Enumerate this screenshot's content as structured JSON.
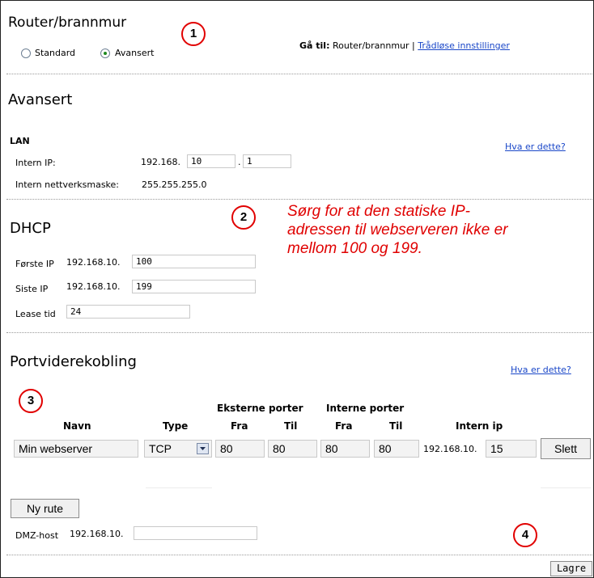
{
  "page": {
    "title": "Router/brannmur",
    "mode_options": [
      {
        "label": "Standard",
        "selected": false
      },
      {
        "label": "Avansert",
        "selected": true
      }
    ],
    "goto_label": "Gå til:",
    "goto_current": "Router/brannmur",
    "goto_separator": "|",
    "goto_link": "Trådløse innstillinger"
  },
  "callouts": [
    "1",
    "2",
    "3",
    "4"
  ],
  "advanced": {
    "heading": "Avansert",
    "lan_label": "LAN",
    "help_link": "Hva er dette?",
    "intern_ip_label": "Intern IP:",
    "intern_ip_prefix": "192.168.",
    "intern_ip_octet3": "10",
    "intern_ip_dot": ".",
    "intern_ip_octet4": "1",
    "netmask_label": "Intern nettverksmaske:",
    "netmask_value": "255.255.255.0"
  },
  "dhcp": {
    "heading": "DHCP",
    "first_ip_label": "Første IP",
    "first_ip_prefix": "192.168.10.",
    "first_ip_value": "100",
    "last_ip_label": "Siste IP",
    "last_ip_prefix": "192.168.10.",
    "last_ip_value": "199",
    "lease_label": "Lease tid",
    "lease_value": "24"
  },
  "annotation": {
    "line1": "Sørg for at den statiske IP-",
    "line2": "adressen til webserveren ikke er",
    "line3": "mellom 100 og 199."
  },
  "port_forwarding": {
    "heading": "Portviderekobling",
    "help_link": "Hva er dette?",
    "group_headers": {
      "external": "Eksterne porter",
      "internal": "Interne porter"
    },
    "columns": {
      "name": "Navn",
      "type": "Type",
      "ext_from": "Fra",
      "ext_to": "Til",
      "int_from": "Fra",
      "int_to": "Til",
      "intern_ip": "Intern ip"
    },
    "rows": [
      {
        "name": "Min webserver",
        "type": "TCP",
        "ext_from": "80",
        "ext_to": "80",
        "int_from": "80",
        "int_to": "80",
        "ip_prefix": "192.168.10.",
        "ip_suffix": "15",
        "delete_label": "Slett"
      }
    ],
    "new_route_label": "Ny rute",
    "dmz_label": "DMZ-host",
    "dmz_prefix": "192.168.10.",
    "dmz_value": ""
  },
  "footer": {
    "save_label": "Lagre"
  },
  "colors": {
    "link": "#1a47c8",
    "callout": "#e10000",
    "annotation": "#e00000"
  }
}
